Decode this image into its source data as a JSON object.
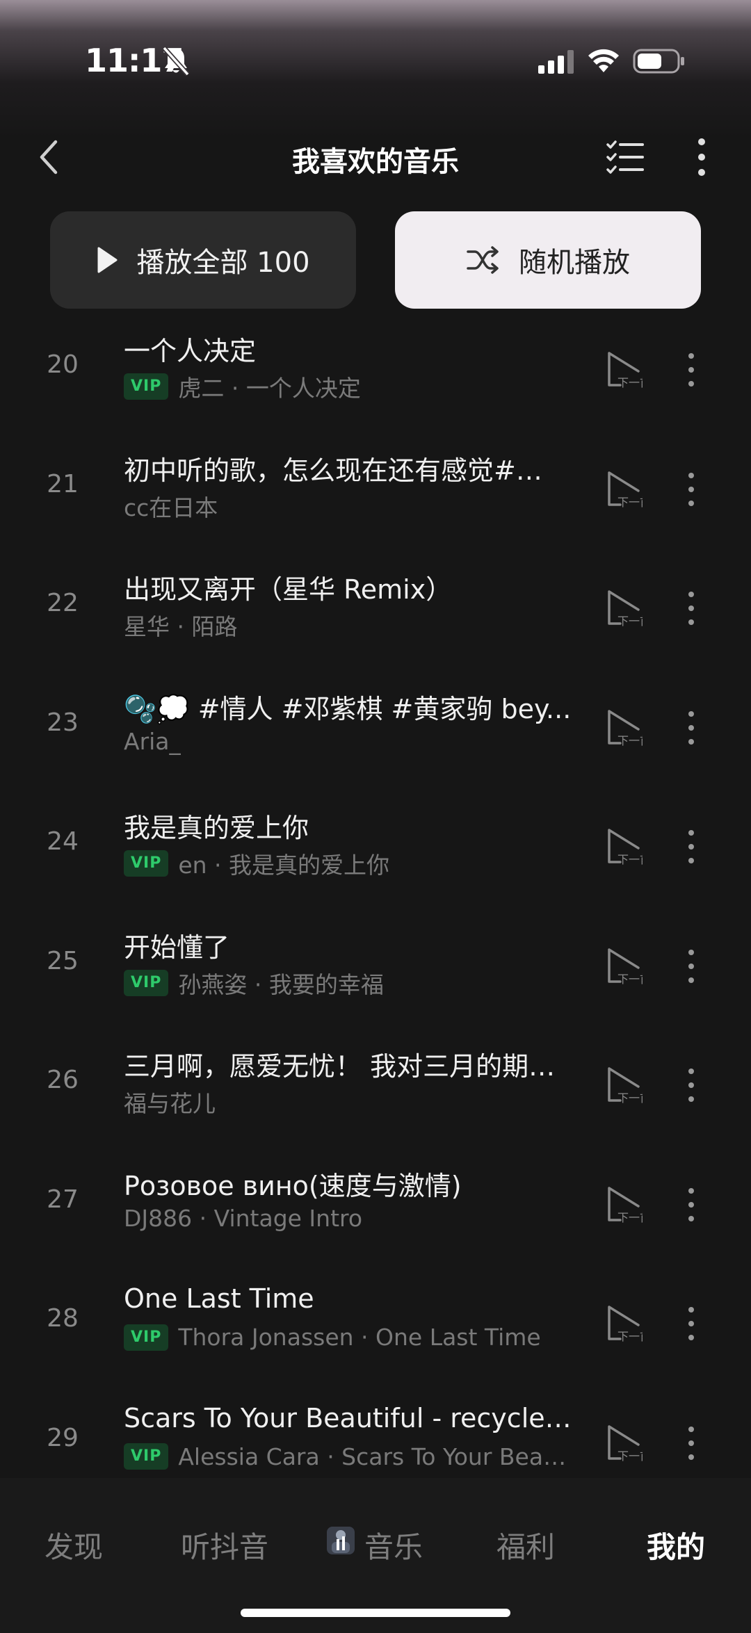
{
  "status_bar": {
    "time": "11:17"
  },
  "header": {
    "title": "我喜欢的音乐"
  },
  "actions": {
    "play_all_label": "播放全部 100",
    "shuffle_label": "随机播放"
  },
  "icons": {
    "next_label": "下一首"
  },
  "songs": [
    {
      "index": "20",
      "title": "一个人决定",
      "vip": true,
      "subtitle": "虎二 · 一个人决定"
    },
    {
      "index": "21",
      "title": "初中听的歌，怎么现在还有感觉#…",
      "vip": false,
      "subtitle": "cc在日本"
    },
    {
      "index": "22",
      "title": "出现又离开（星华 Remix）",
      "vip": false,
      "subtitle": "星华 · 陌路"
    },
    {
      "index": "23",
      "title": "🫧💭 #情人 #邓紫棋 #黄家驹 bey...",
      "vip": false,
      "subtitle": "Aria_"
    },
    {
      "index": "24",
      "title": "我是真的爱上你",
      "vip": true,
      "subtitle": "en · 我是真的爱上你"
    },
    {
      "index": "25",
      "title": "开始懂了",
      "vip": true,
      "subtitle": "孙燕姿 · 我要的幸福"
    },
    {
      "index": "26",
      "title": "三月啊，愿爱无忧！ 我对三月的期…",
      "vip": false,
      "subtitle": "福与花儿"
    },
    {
      "index": "27",
      "title": "Розовое вино(速度与激情)",
      "vip": false,
      "subtitle": "DJ886 · Vintage Intro"
    },
    {
      "index": "28",
      "title": "One Last Time",
      "vip": true,
      "subtitle": "Thora Jonassen · One Last Time"
    },
    {
      "index": "29",
      "title": "Scars To Your Beautiful - recycle j...",
      "vip": true,
      "subtitle": "Alessia Cara · Scars To Your Beau..."
    }
  ],
  "vip_label": "VIP",
  "bottom_nav": {
    "items": [
      {
        "label": "发现"
      },
      {
        "label": "听抖音"
      },
      {
        "label": "音乐"
      },
      {
        "label": "福利"
      },
      {
        "label": "我的"
      }
    ],
    "active": "我的"
  },
  "colors": {
    "background": "#161616",
    "vip_text": "#2ecb6b",
    "vip_bg": "#163d25",
    "shuffle_bg": "#f1edf1"
  }
}
